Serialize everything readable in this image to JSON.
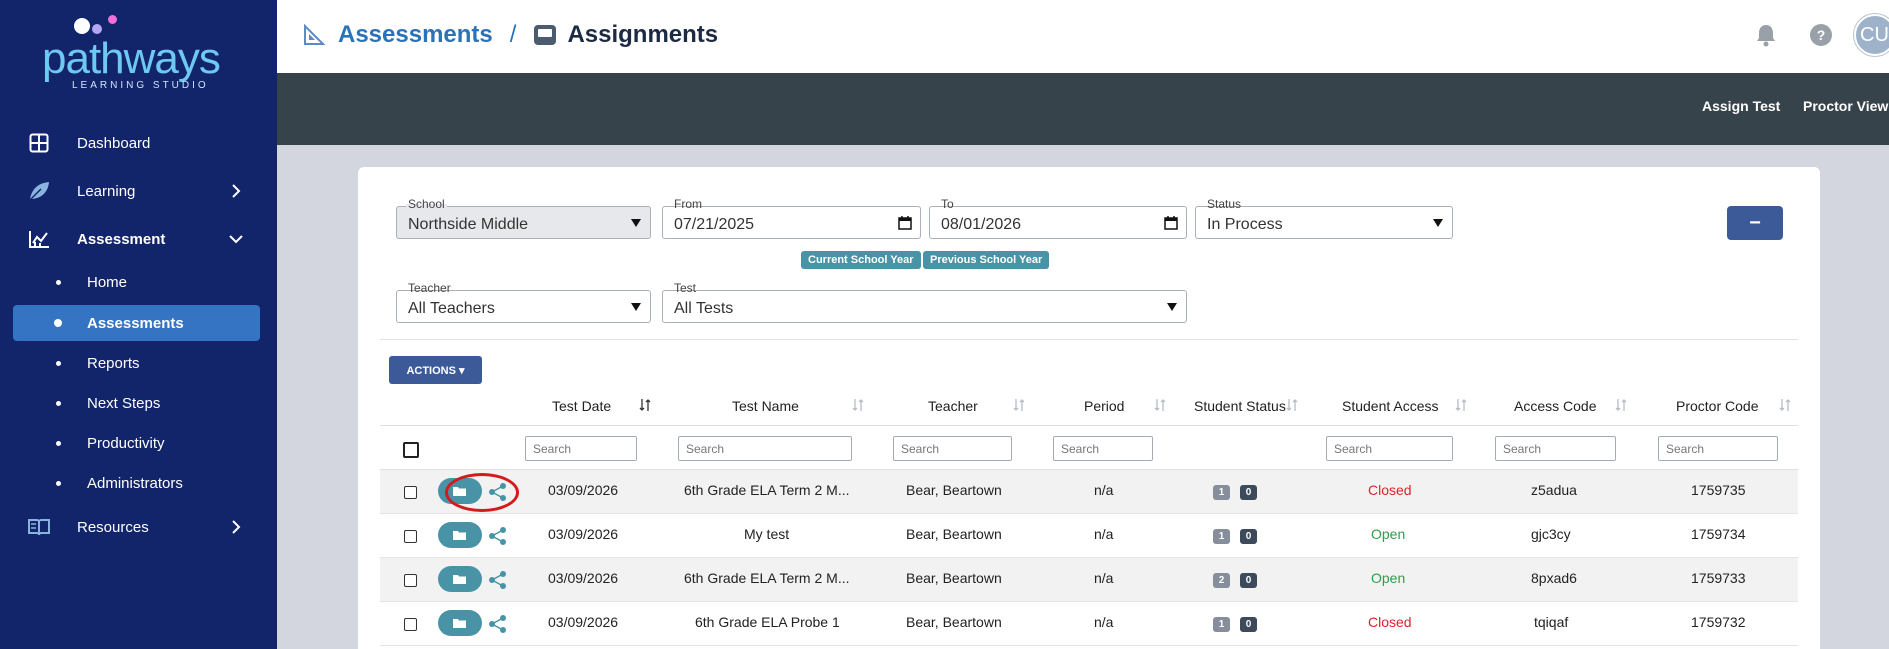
{
  "brand": {
    "name": "pathways",
    "tagline": "LEARNING STUDIO"
  },
  "sidebar": {
    "items": [
      {
        "label": "Dashboard",
        "icon": "dashboard-icon"
      },
      {
        "label": "Learning",
        "icon": "leaf-icon"
      },
      {
        "label": "Assessment",
        "icon": "chart-icon",
        "expanded": true
      },
      {
        "label": "Resources",
        "icon": "book-icon"
      }
    ],
    "assessment_sub": [
      {
        "label": "Home"
      },
      {
        "label": "Assessments",
        "active": true
      },
      {
        "label": "Reports"
      },
      {
        "label": "Next Steps"
      },
      {
        "label": "Productivity"
      },
      {
        "label": "Administrators"
      }
    ]
  },
  "header": {
    "breadcrumb_parent": "Assessments",
    "separator": "/",
    "breadcrumb_current": "Assignments",
    "avatar_initials": "CU"
  },
  "actionbar": {
    "assign_test": "Assign Test",
    "proctor_view": "Proctor View"
  },
  "filters": {
    "school": {
      "label": "School",
      "value": "Northside Middle"
    },
    "from": {
      "label": "From",
      "value": "07/21/2025"
    },
    "to": {
      "label": "To",
      "value": "08/01/2026"
    },
    "status": {
      "label": "Status",
      "value": "In Process"
    },
    "teacher": {
      "label": "Teacher",
      "value": "All Teachers"
    },
    "test": {
      "label": "Test",
      "value": "All Tests"
    },
    "chips": [
      "Current School Year",
      "Previous School Year"
    ],
    "collapse_label": "−"
  },
  "actions_label": "ACTIONS ▾",
  "table": {
    "columns": [
      "Test Date",
      "Test Name",
      "Teacher",
      "Period",
      "Student Status",
      "Student Access",
      "Access Code",
      "Proctor Code"
    ],
    "search_placeholder": "Search",
    "rows": [
      {
        "date": "03/09/2026",
        "name": "6th Grade ELA Term 2 M...",
        "teacher": "Bear, Beartown",
        "period": "n/a",
        "status_a": "1",
        "status_b": "0",
        "access": "Closed",
        "access_code": "z5adua",
        "proctor_code": "1759735"
      },
      {
        "date": "03/09/2026",
        "name": "My test",
        "teacher": "Bear, Beartown",
        "period": "n/a",
        "status_a": "1",
        "status_b": "0",
        "access": "Open",
        "access_code": "gjc3cy",
        "proctor_code": "1759734"
      },
      {
        "date": "03/09/2026",
        "name": "6th Grade ELA Term 2 M...",
        "teacher": "Bear, Beartown",
        "period": "n/a",
        "status_a": "2",
        "status_b": "0",
        "access": "Open",
        "access_code": "8pxad6",
        "proctor_code": "1759733"
      },
      {
        "date": "03/09/2026",
        "name": "6th Grade ELA Probe 1",
        "teacher": "Bear, Beartown",
        "period": "n/a",
        "status_a": "1",
        "status_b": "0",
        "access": "Closed",
        "access_code": "tqiqaf",
        "proctor_code": "1759732"
      }
    ]
  },
  "colors": {
    "sidebar": "#12246a",
    "active": "#3573c3",
    "teal": "#4893a6",
    "primary_btn": "#3c5a98",
    "closed": "#d9242e",
    "open": "#2aa04a"
  }
}
